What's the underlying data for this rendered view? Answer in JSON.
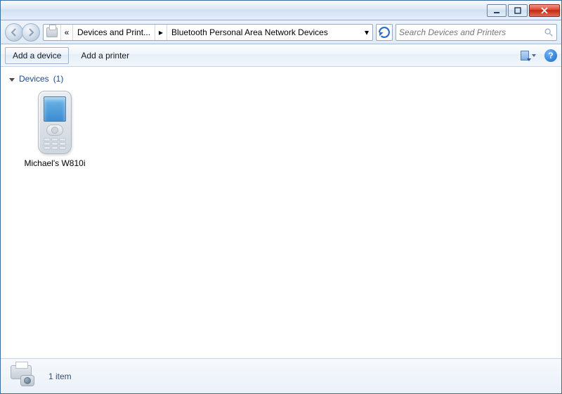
{
  "breadcrumb": {
    "level1": "Devices and Print...",
    "level2": "Bluetooth Personal Area Network Devices"
  },
  "search": {
    "placeholder": "Search Devices and Printers"
  },
  "toolbar": {
    "add_device": "Add a device",
    "add_printer": "Add a printer"
  },
  "group": {
    "label": "Devices",
    "count": "(1)"
  },
  "devices": [
    {
      "name": "Michael's W810i"
    }
  ],
  "statusbar": {
    "summary": "1 item"
  },
  "help_glyph": "?"
}
